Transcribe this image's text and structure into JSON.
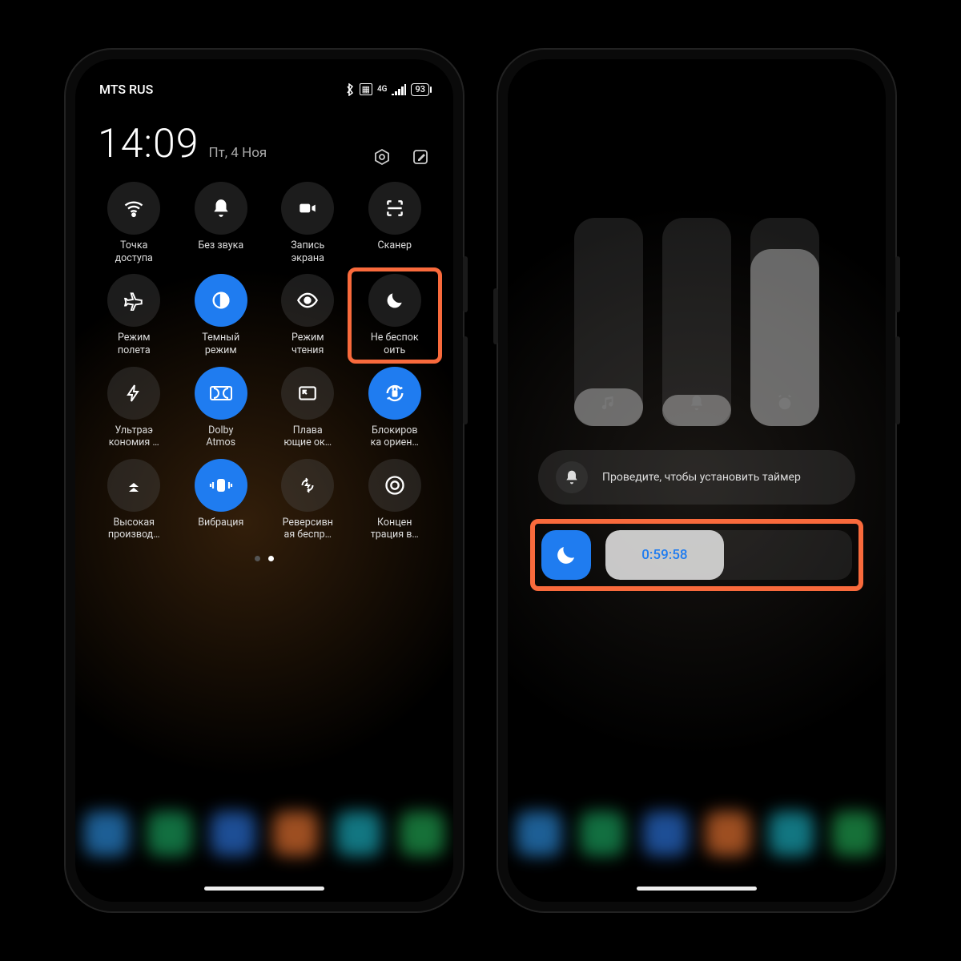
{
  "colors": {
    "accent": "#1f7cf0",
    "highlight": "#f96a3c"
  },
  "status": {
    "carrier": "MTS RUS",
    "network": "4G",
    "battery": "93"
  },
  "header": {
    "time": "14:09",
    "date": "Пт, 4 Ноя"
  },
  "tiles": [
    {
      "label": "Точка\nдоступа",
      "icon": "wifi",
      "active": false
    },
    {
      "label": "Без звука",
      "icon": "bell",
      "active": false
    },
    {
      "label": "Запись\nэкрана",
      "icon": "video",
      "active": false
    },
    {
      "label": "Сканер",
      "icon": "scan",
      "active": false
    },
    {
      "label": "Режим\nполета",
      "icon": "plane",
      "active": false
    },
    {
      "label": "Темный\nрежим",
      "icon": "darkmode",
      "active": true
    },
    {
      "label": "Режим\nчтения",
      "icon": "eye",
      "active": false
    },
    {
      "label": "Не беспок\nоить",
      "icon": "moon",
      "active": false,
      "highlighted": true
    },
    {
      "label": "Ультраэ\nкономия …",
      "icon": "bolt",
      "active": false
    },
    {
      "label": "Dolby\nAtmos",
      "icon": "dolby",
      "active": true
    },
    {
      "label": "Плава\nющие ок…",
      "icon": "pip",
      "active": false
    },
    {
      "label": "Блокиров\nка ориен…",
      "icon": "lockrot",
      "active": true
    },
    {
      "label": "Высокая\nпроизвод…",
      "icon": "boost",
      "active": false
    },
    {
      "label": "Вибрация",
      "icon": "vibrate",
      "active": true
    },
    {
      "label": "Реверсивн\nая беспр…",
      "icon": "revcharge",
      "active": false
    },
    {
      "label": "Концен\nтрация в…",
      "icon": "focus",
      "active": false
    }
  ],
  "pager": {
    "current": 1,
    "total": 2
  },
  "right": {
    "volume_fills": [
      0.18,
      0.15,
      0.85
    ],
    "hint": "Проведите, чтобы установить таймер",
    "timer_value": "0:59:58",
    "timer_progress": 0.48
  }
}
